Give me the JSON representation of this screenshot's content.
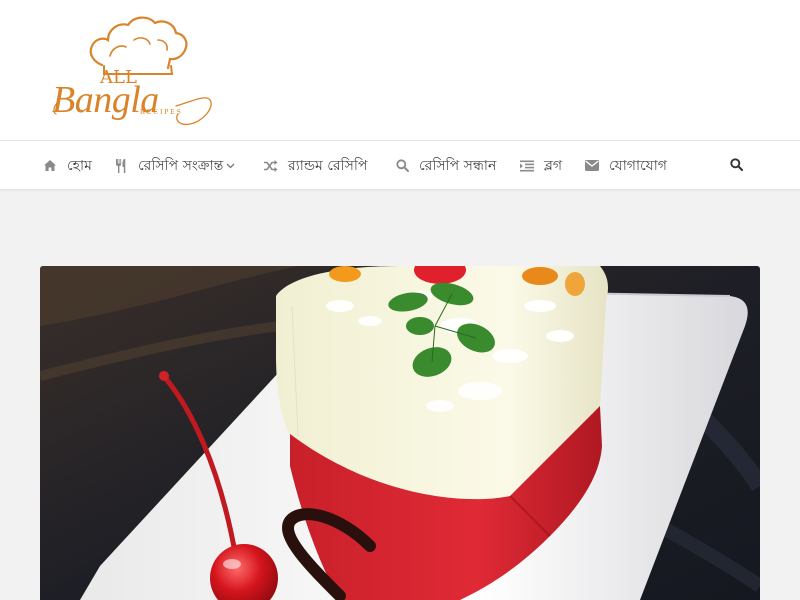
{
  "site": {
    "logo": {
      "line1": "ALL",
      "line2": "Bangla",
      "line3": "RECIPES",
      "color": "#d9842a"
    }
  },
  "nav": {
    "items": [
      {
        "label": "হোম",
        "icon": "home-icon"
      },
      {
        "label": "রেসিপি সংক্রান্ত",
        "icon": "utensils-icon",
        "has_dropdown": true
      },
      {
        "label": "র‍্যান্ডম রেসিপি",
        "icon": "shuffle-icon"
      },
      {
        "label": "রেসিপি সন্ধান",
        "icon": "search-icon"
      },
      {
        "label": "ব্লগ",
        "icon": "list-icon"
      },
      {
        "label": "যোগাযোগ",
        "icon": "envelope-icon"
      }
    ],
    "search_icon": "search-icon"
  },
  "featured": {
    "image": "cheesecake-slice-photo"
  },
  "colors": {
    "accent": "#d9842a",
    "nav_text": "#444444",
    "icon_gray": "#8a8a8a",
    "page_bg": "#f2f2f2"
  }
}
